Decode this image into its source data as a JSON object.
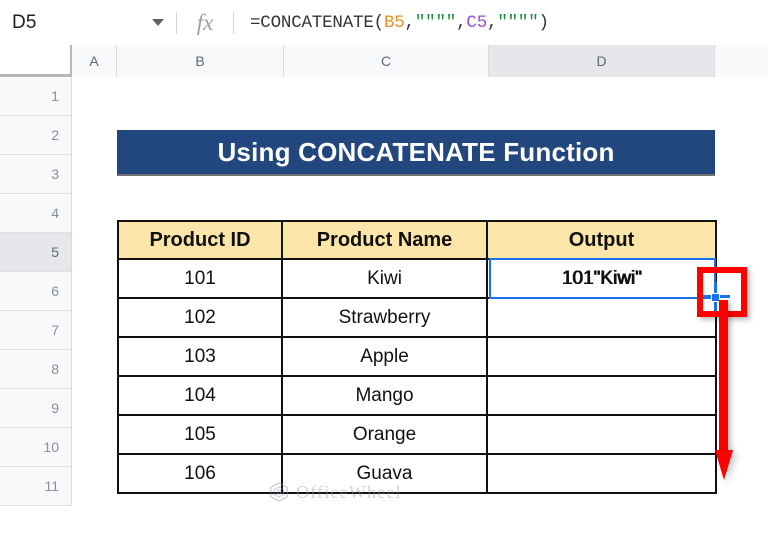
{
  "formula_bar": {
    "name_box_value": "D5",
    "caret_icon": "chevron-down-icon",
    "fx_icon": "fx-icon",
    "formula_full": "=CONCATENATE(B5,\"\"\"\",C5,\"\"\"\")",
    "formula_tokens": [
      {
        "text": "=CONCATENATE(",
        "type": "plain"
      },
      {
        "text": "B5",
        "type": "ref-b"
      },
      {
        "text": ",",
        "type": "plain"
      },
      {
        "text": "\"\"\"\"",
        "type": "str"
      },
      {
        "text": ",",
        "type": "plain"
      },
      {
        "text": "C5",
        "type": "ref-c"
      },
      {
        "text": ",",
        "type": "plain"
      },
      {
        "text": "\"\"\"\"",
        "type": "str"
      },
      {
        "text": ")",
        "type": "plain"
      }
    ]
  },
  "grid": {
    "column_headers": [
      "A",
      "B",
      "C",
      "D"
    ],
    "active_column": "D",
    "row_headers": [
      "1",
      "2",
      "3",
      "4",
      "5",
      "6",
      "7",
      "8",
      "9",
      "10",
      "11"
    ],
    "active_row": "5"
  },
  "title_banner": {
    "text": "Using CONCATENATE Function",
    "background_color": "#22477f",
    "text_color": "#ffffff"
  },
  "table": {
    "header_background": "#fce5a8",
    "headers": [
      "Product ID",
      "Product Name",
      "Output"
    ],
    "rows": [
      {
        "product_id": "101",
        "product_name": "Kiwi",
        "output": "101\"Kiwi\""
      },
      {
        "product_id": "102",
        "product_name": "Strawberry",
        "output": ""
      },
      {
        "product_id": "103",
        "product_name": "Apple",
        "output": ""
      },
      {
        "product_id": "104",
        "product_name": "Mango",
        "output": ""
      },
      {
        "product_id": "105",
        "product_name": "Orange",
        "output": ""
      },
      {
        "product_id": "106",
        "product_name": "Guava",
        "output": ""
      }
    ]
  },
  "selection": {
    "cell": "D5",
    "displayed_value": "101\"Kiwi\"",
    "border_color": "#1a73e8",
    "fill_handle_icon": "fill-handle-crosshair-icon"
  },
  "annotation": {
    "box_color": "#ff0000",
    "arrow_color": "#ff0000",
    "box_icon": "highlight-box",
    "arrow_icon": "down-arrow-icon"
  },
  "watermark": {
    "text": "OfficeWheel",
    "logo_icon": "officewheel-hex-logo-icon"
  }
}
